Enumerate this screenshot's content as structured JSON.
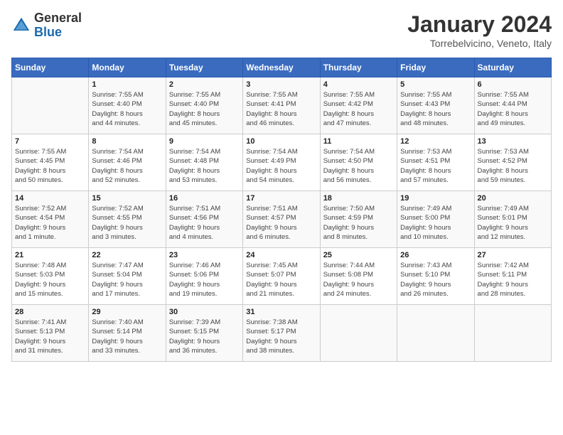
{
  "header": {
    "logo_general": "General",
    "logo_blue": "Blue",
    "title": "January 2024",
    "location": "Torrebelvicino, Veneto, Italy"
  },
  "calendar": {
    "weekdays": [
      "Sunday",
      "Monday",
      "Tuesday",
      "Wednesday",
      "Thursday",
      "Friday",
      "Saturday"
    ],
    "weeks": [
      [
        {
          "day": "",
          "info": ""
        },
        {
          "day": "1",
          "info": "Sunrise: 7:55 AM\nSunset: 4:40 PM\nDaylight: 8 hours\nand 44 minutes."
        },
        {
          "day": "2",
          "info": "Sunrise: 7:55 AM\nSunset: 4:40 PM\nDaylight: 8 hours\nand 45 minutes."
        },
        {
          "day": "3",
          "info": "Sunrise: 7:55 AM\nSunset: 4:41 PM\nDaylight: 8 hours\nand 46 minutes."
        },
        {
          "day": "4",
          "info": "Sunrise: 7:55 AM\nSunset: 4:42 PM\nDaylight: 8 hours\nand 47 minutes."
        },
        {
          "day": "5",
          "info": "Sunrise: 7:55 AM\nSunset: 4:43 PM\nDaylight: 8 hours\nand 48 minutes."
        },
        {
          "day": "6",
          "info": "Sunrise: 7:55 AM\nSunset: 4:44 PM\nDaylight: 8 hours\nand 49 minutes."
        }
      ],
      [
        {
          "day": "7",
          "info": "Sunrise: 7:55 AM\nSunset: 4:45 PM\nDaylight: 8 hours\nand 50 minutes."
        },
        {
          "day": "8",
          "info": "Sunrise: 7:54 AM\nSunset: 4:46 PM\nDaylight: 8 hours\nand 52 minutes."
        },
        {
          "day": "9",
          "info": "Sunrise: 7:54 AM\nSunset: 4:48 PM\nDaylight: 8 hours\nand 53 minutes."
        },
        {
          "day": "10",
          "info": "Sunrise: 7:54 AM\nSunset: 4:49 PM\nDaylight: 8 hours\nand 54 minutes."
        },
        {
          "day": "11",
          "info": "Sunrise: 7:54 AM\nSunset: 4:50 PM\nDaylight: 8 hours\nand 56 minutes."
        },
        {
          "day": "12",
          "info": "Sunrise: 7:53 AM\nSunset: 4:51 PM\nDaylight: 8 hours\nand 57 minutes."
        },
        {
          "day": "13",
          "info": "Sunrise: 7:53 AM\nSunset: 4:52 PM\nDaylight: 8 hours\nand 59 minutes."
        }
      ],
      [
        {
          "day": "14",
          "info": "Sunrise: 7:52 AM\nSunset: 4:54 PM\nDaylight: 9 hours\nand 1 minute."
        },
        {
          "day": "15",
          "info": "Sunrise: 7:52 AM\nSunset: 4:55 PM\nDaylight: 9 hours\nand 3 minutes."
        },
        {
          "day": "16",
          "info": "Sunrise: 7:51 AM\nSunset: 4:56 PM\nDaylight: 9 hours\nand 4 minutes."
        },
        {
          "day": "17",
          "info": "Sunrise: 7:51 AM\nSunset: 4:57 PM\nDaylight: 9 hours\nand 6 minutes."
        },
        {
          "day": "18",
          "info": "Sunrise: 7:50 AM\nSunset: 4:59 PM\nDaylight: 9 hours\nand 8 minutes."
        },
        {
          "day": "19",
          "info": "Sunrise: 7:49 AM\nSunset: 5:00 PM\nDaylight: 9 hours\nand 10 minutes."
        },
        {
          "day": "20",
          "info": "Sunrise: 7:49 AM\nSunset: 5:01 PM\nDaylight: 9 hours\nand 12 minutes."
        }
      ],
      [
        {
          "day": "21",
          "info": "Sunrise: 7:48 AM\nSunset: 5:03 PM\nDaylight: 9 hours\nand 15 minutes."
        },
        {
          "day": "22",
          "info": "Sunrise: 7:47 AM\nSunset: 5:04 PM\nDaylight: 9 hours\nand 17 minutes."
        },
        {
          "day": "23",
          "info": "Sunrise: 7:46 AM\nSunset: 5:06 PM\nDaylight: 9 hours\nand 19 minutes."
        },
        {
          "day": "24",
          "info": "Sunrise: 7:45 AM\nSunset: 5:07 PM\nDaylight: 9 hours\nand 21 minutes."
        },
        {
          "day": "25",
          "info": "Sunrise: 7:44 AM\nSunset: 5:08 PM\nDaylight: 9 hours\nand 24 minutes."
        },
        {
          "day": "26",
          "info": "Sunrise: 7:43 AM\nSunset: 5:10 PM\nDaylight: 9 hours\nand 26 minutes."
        },
        {
          "day": "27",
          "info": "Sunrise: 7:42 AM\nSunset: 5:11 PM\nDaylight: 9 hours\nand 28 minutes."
        }
      ],
      [
        {
          "day": "28",
          "info": "Sunrise: 7:41 AM\nSunset: 5:13 PM\nDaylight: 9 hours\nand 31 minutes."
        },
        {
          "day": "29",
          "info": "Sunrise: 7:40 AM\nSunset: 5:14 PM\nDaylight: 9 hours\nand 33 minutes."
        },
        {
          "day": "30",
          "info": "Sunrise: 7:39 AM\nSunset: 5:15 PM\nDaylight: 9 hours\nand 36 minutes."
        },
        {
          "day": "31",
          "info": "Sunrise: 7:38 AM\nSunset: 5:17 PM\nDaylight: 9 hours\nand 38 minutes."
        },
        {
          "day": "",
          "info": ""
        },
        {
          "day": "",
          "info": ""
        },
        {
          "day": "",
          "info": ""
        }
      ]
    ]
  }
}
